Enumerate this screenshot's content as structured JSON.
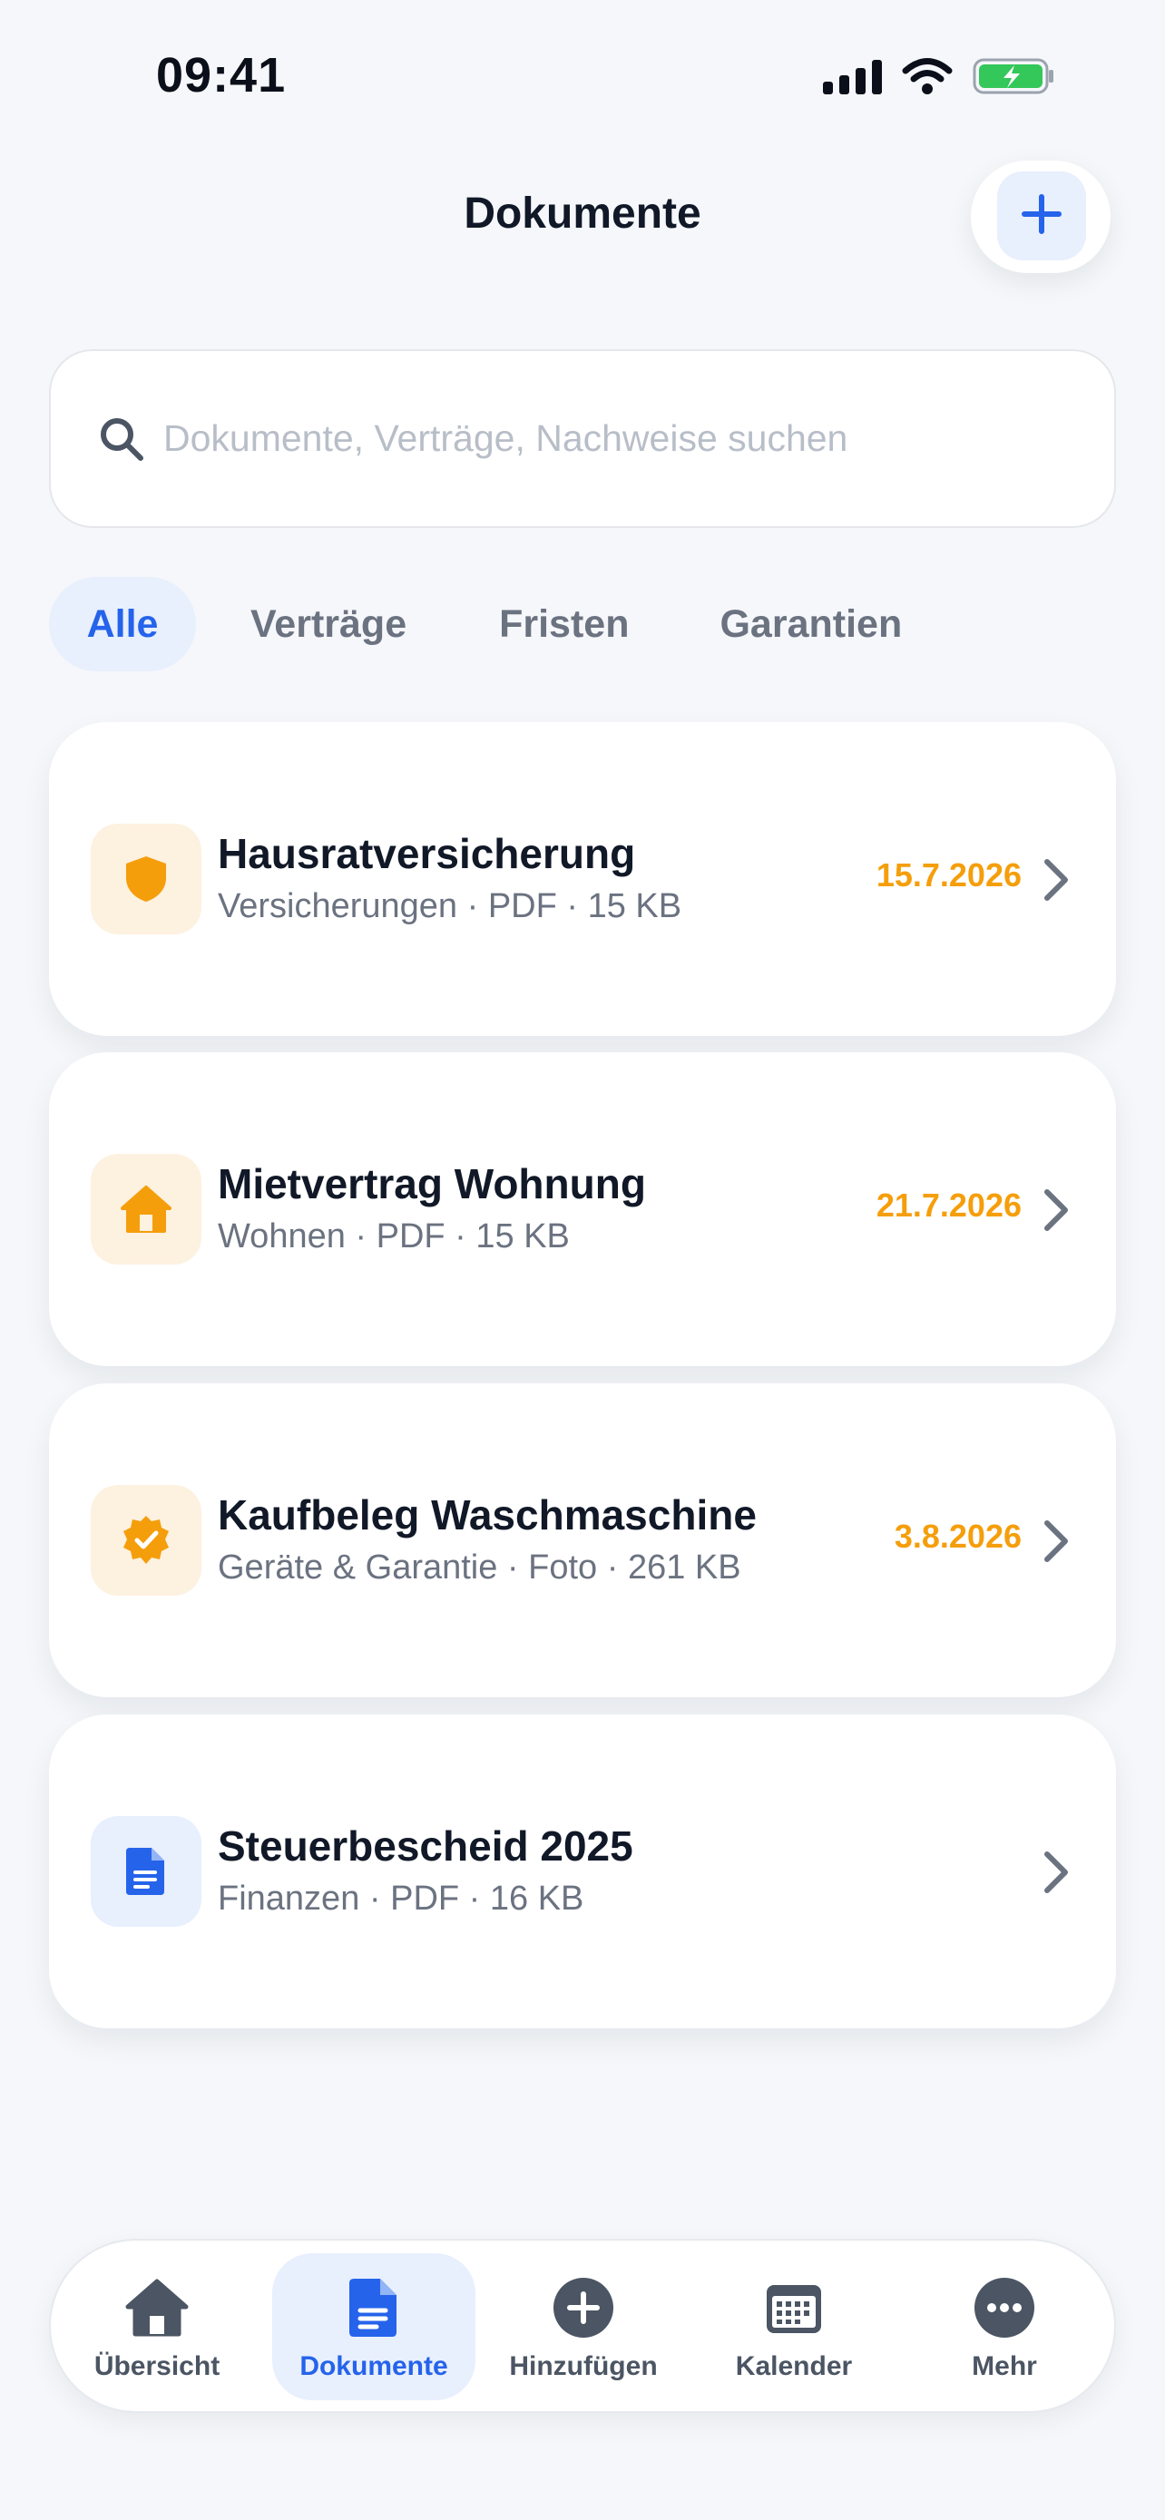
{
  "status_bar": {
    "time": "09:41"
  },
  "header": {
    "title": "Dokumente",
    "add_icon": "plus-icon"
  },
  "search": {
    "placeholder": "Dokumente, Verträge, Nachweise suchen",
    "value": "",
    "icon": "search-icon"
  },
  "filters": [
    {
      "label": "Alle",
      "active": true
    },
    {
      "label": "Verträge",
      "active": false
    },
    {
      "label": "Fristen",
      "active": false
    },
    {
      "label": "Garantien",
      "active": false
    }
  ],
  "documents": [
    {
      "title": "Hausratversicherung",
      "meta": "Versicherungen · PDF · 15 KB",
      "date": "15.7.2026",
      "icon": "shield-icon"
    },
    {
      "title": "Mietvertrag Wohnung",
      "meta": "Wohnen · PDF · 15 KB",
      "date": "21.7.2026",
      "icon": "house-icon"
    },
    {
      "title": "Kaufbeleg Waschmaschine",
      "meta": "Geräte & Garantie · Foto · 261 KB",
      "date": "3.8.2026",
      "icon": "badge-check-icon"
    },
    {
      "title": "Steuerbescheid 2025",
      "meta": "Finanzen · PDF · 16 KB",
      "date": "",
      "icon": "document-icon"
    }
  ],
  "bottom_nav": [
    {
      "label": "Übersicht",
      "icon": "house-icon",
      "active": false
    },
    {
      "label": "Dokumente",
      "icon": "document-icon",
      "active": true
    },
    {
      "label": "Hinzufügen",
      "icon": "plus-circle-icon",
      "active": false
    },
    {
      "label": "Kalender",
      "icon": "calendar-icon",
      "active": false
    },
    {
      "label": "Mehr",
      "icon": "more-icon",
      "active": false
    }
  ],
  "colors": {
    "accent": "#2563eb",
    "accent_bg": "#e8effd",
    "warning": "#f59e0b",
    "warning_bg": "#fdf1e0",
    "battery": "#34c759"
  }
}
